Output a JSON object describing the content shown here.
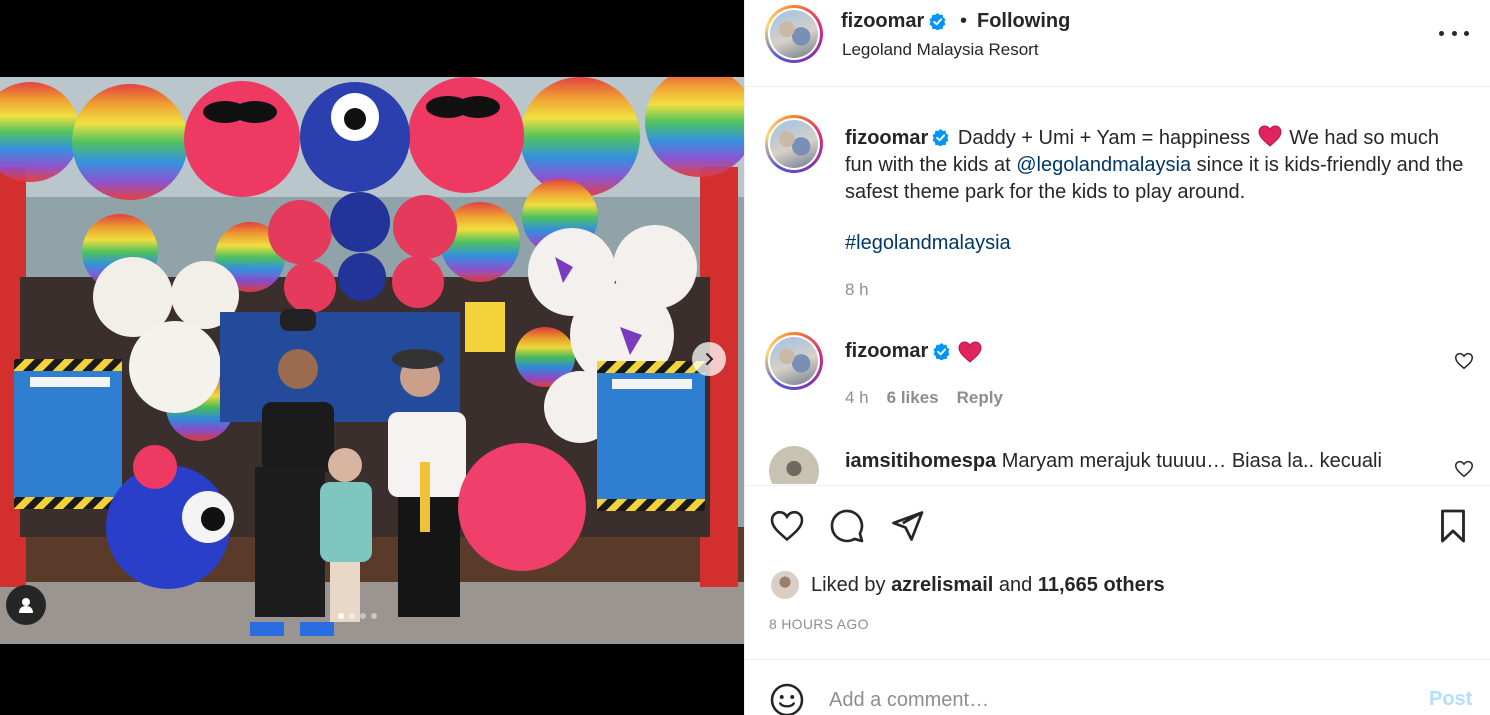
{
  "post": {
    "username": "fizoomar",
    "separator": "•",
    "follow_status": "Following",
    "location": "Legoland Malaysia Resort",
    "carousel": {
      "slide_count": 4,
      "active_index": 0
    }
  },
  "caption": {
    "username": "fizoomar",
    "text_1": "Daddy + Umi + Yam = happiness",
    "text_2": "We had so much fun with the kids at",
    "mention": "@legolandmalaysia",
    "text_3": "since it is kids-friendly and the safest theme park for the kids to play around.",
    "hashtag": "#legolandmalaysia",
    "time": "8 h"
  },
  "comments": [
    {
      "username": "fizoomar",
      "time": "4 h",
      "likes": "6 likes",
      "reply": "Reply"
    },
    {
      "username": "iamsitihomespa",
      "text": "Maryam merajuk tuuuu… Biasa la.. kecuali"
    }
  ],
  "likes": {
    "prefix": "Liked by",
    "user": "azrelismail",
    "joiner": "and",
    "others": "11,665 others"
  },
  "timestamp": "8 HOURS AGO",
  "composer": {
    "placeholder": "Add a comment…",
    "post_label": "Post"
  },
  "icons": {
    "heart": "heart-icon",
    "comment": "comment-icon",
    "share": "share-icon",
    "save": "bookmark-icon",
    "emoji": "emoji-icon",
    "more": "more-options-icon",
    "verified": "verified-badge-icon",
    "next": "chevron-right-icon",
    "tags": "user-tag-icon"
  },
  "colors": {
    "link": "#00376b",
    "muted": "#8e8e8e",
    "verified": "#0095f6",
    "post_disabled": "#b2dffc",
    "heart_emoji": "#e0245e"
  }
}
